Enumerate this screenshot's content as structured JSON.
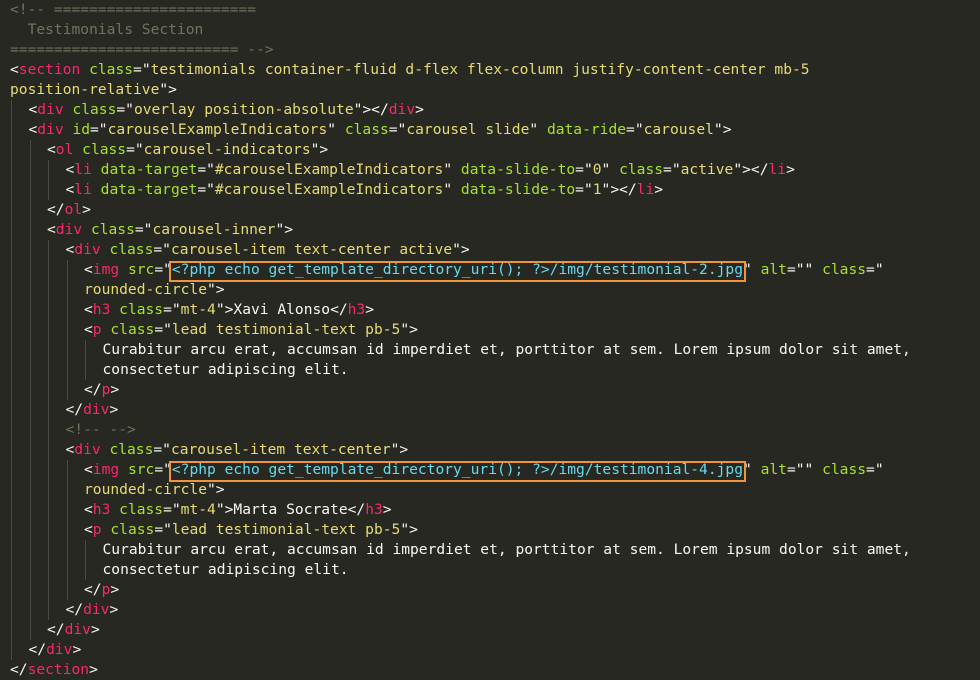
{
  "editor": {
    "theme": "monokai",
    "colors": {
      "background": "#272822",
      "text": "#f8f8f2",
      "comment": "#75715e",
      "tag": "#f92672",
      "attribute": "#a6e22e",
      "string": "#e6db74",
      "php": "#66d9ef",
      "highlight_box": "#f0953a"
    },
    "highlighted_lines": [
      13,
      23
    ],
    "lines": [
      {
        "indent": 0,
        "tokens": [
          {
            "t": "c",
            "v": "<!-- ======================="
          }
        ]
      },
      {
        "indent": 0,
        "tokens": [
          {
            "t": "c",
            "v": "  Testimonials Section"
          }
        ]
      },
      {
        "indent": 0,
        "tokens": [
          {
            "t": "c",
            "v": "========================== -->"
          }
        ]
      },
      {
        "indent": 0,
        "tokens": [
          {
            "t": "p",
            "v": "<"
          },
          {
            "t": "g",
            "v": "section"
          },
          {
            "t": "a",
            "v": " class"
          },
          {
            "t": "p",
            "v": "=\""
          },
          {
            "t": "s",
            "v": "testimonials container-fluid d-flex flex-column justify-content-center mb-5"
          }
        ]
      },
      {
        "indent": 0,
        "tokens": [
          {
            "t": "s",
            "v": "position-relative"
          },
          {
            "t": "p",
            "v": "\">"
          }
        ]
      },
      {
        "indent": 1,
        "tokens": [
          {
            "t": "p",
            "v": "<"
          },
          {
            "t": "g",
            "v": "div"
          },
          {
            "t": "a",
            "v": " class"
          },
          {
            "t": "p",
            "v": "=\""
          },
          {
            "t": "s",
            "v": "overlay position-absolute"
          },
          {
            "t": "p",
            "v": "\"></"
          },
          {
            "t": "g",
            "v": "div"
          },
          {
            "t": "p",
            "v": ">"
          }
        ]
      },
      {
        "indent": 1,
        "tokens": [
          {
            "t": "p",
            "v": "<"
          },
          {
            "t": "g",
            "v": "div"
          },
          {
            "t": "a",
            "v": " id"
          },
          {
            "t": "p",
            "v": "=\""
          },
          {
            "t": "s",
            "v": "carouselExampleIndicators"
          },
          {
            "t": "p",
            "v": "\""
          },
          {
            "t": "a",
            "v": " class"
          },
          {
            "t": "p",
            "v": "=\""
          },
          {
            "t": "s",
            "v": "carousel slide"
          },
          {
            "t": "p",
            "v": "\""
          },
          {
            "t": "a",
            "v": " data-ride"
          },
          {
            "t": "p",
            "v": "=\""
          },
          {
            "t": "s",
            "v": "carousel"
          },
          {
            "t": "p",
            "v": "\">"
          }
        ]
      },
      {
        "indent": 2,
        "tokens": [
          {
            "t": "p",
            "v": "<"
          },
          {
            "t": "g",
            "v": "ol"
          },
          {
            "t": "a",
            "v": " class"
          },
          {
            "t": "p",
            "v": "=\""
          },
          {
            "t": "s",
            "v": "carousel-indicators"
          },
          {
            "t": "p",
            "v": "\">"
          }
        ]
      },
      {
        "indent": 3,
        "tokens": [
          {
            "t": "p",
            "v": "<"
          },
          {
            "t": "g",
            "v": "li"
          },
          {
            "t": "a",
            "v": " data-target"
          },
          {
            "t": "p",
            "v": "=\""
          },
          {
            "t": "s",
            "v": "#carouselExampleIndicators"
          },
          {
            "t": "p",
            "v": "\""
          },
          {
            "t": "a",
            "v": " data-slide-to"
          },
          {
            "t": "p",
            "v": "=\""
          },
          {
            "t": "s",
            "v": "0"
          },
          {
            "t": "p",
            "v": "\""
          },
          {
            "t": "a",
            "v": " class"
          },
          {
            "t": "p",
            "v": "=\""
          },
          {
            "t": "s",
            "v": "active"
          },
          {
            "t": "p",
            "v": "\"></"
          },
          {
            "t": "g",
            "v": "li"
          },
          {
            "t": "p",
            "v": ">"
          }
        ]
      },
      {
        "indent": 3,
        "tokens": [
          {
            "t": "p",
            "v": "<"
          },
          {
            "t": "g",
            "v": "li"
          },
          {
            "t": "a",
            "v": " data-target"
          },
          {
            "t": "p",
            "v": "=\""
          },
          {
            "t": "s",
            "v": "#carouselExampleIndicators"
          },
          {
            "t": "p",
            "v": "\""
          },
          {
            "t": "a",
            "v": " data-slide-to"
          },
          {
            "t": "p",
            "v": "=\""
          },
          {
            "t": "s",
            "v": "1"
          },
          {
            "t": "p",
            "v": "\"></"
          },
          {
            "t": "g",
            "v": "li"
          },
          {
            "t": "p",
            "v": ">"
          }
        ]
      },
      {
        "indent": 2,
        "tokens": [
          {
            "t": "p",
            "v": "</"
          },
          {
            "t": "g",
            "v": "ol"
          },
          {
            "t": "p",
            "v": ">"
          }
        ]
      },
      {
        "indent": 2,
        "tokens": [
          {
            "t": "p",
            "v": "<"
          },
          {
            "t": "g",
            "v": "div"
          },
          {
            "t": "a",
            "v": " class"
          },
          {
            "t": "p",
            "v": "=\""
          },
          {
            "t": "s",
            "v": "carousel-inner"
          },
          {
            "t": "p",
            "v": "\">"
          }
        ]
      },
      {
        "indent": 3,
        "tokens": [
          {
            "t": "p",
            "v": "<"
          },
          {
            "t": "g",
            "v": "div"
          },
          {
            "t": "a",
            "v": " class"
          },
          {
            "t": "p",
            "v": "=\""
          },
          {
            "t": "s",
            "v": "carousel-item text-center active"
          },
          {
            "t": "p",
            "v": "\">"
          }
        ]
      },
      {
        "indent": 4,
        "tokens": [
          {
            "t": "p",
            "v": "<"
          },
          {
            "t": "g",
            "v": "img"
          },
          {
            "t": "a",
            "v": " src"
          },
          {
            "t": "p",
            "v": "=\""
          },
          {
            "t": "h",
            "v": "<?php echo get_template_directory_uri(); ?>/img/testimonial-2.jpg"
          },
          {
            "t": "p",
            "v": "\""
          },
          {
            "t": "a",
            "v": " alt"
          },
          {
            "t": "p",
            "v": "=\"\""
          },
          {
            "t": "a",
            "v": " class"
          },
          {
            "t": "p",
            "v": "=\""
          }
        ]
      },
      {
        "indent": 4,
        "tokens": [
          {
            "t": "s",
            "v": "rounded-circle"
          },
          {
            "t": "p",
            "v": "\">"
          }
        ]
      },
      {
        "indent": 4,
        "tokens": [
          {
            "t": "p",
            "v": "<"
          },
          {
            "t": "g",
            "v": "h3"
          },
          {
            "t": "a",
            "v": " class"
          },
          {
            "t": "p",
            "v": "=\""
          },
          {
            "t": "s",
            "v": "mt-4"
          },
          {
            "t": "p",
            "v": "\">"
          },
          {
            "t": "x",
            "v": "Xavi Alonso"
          },
          {
            "t": "p",
            "v": "</"
          },
          {
            "t": "g",
            "v": "h3"
          },
          {
            "t": "p",
            "v": ">"
          }
        ]
      },
      {
        "indent": 4,
        "tokens": [
          {
            "t": "p",
            "v": "<"
          },
          {
            "t": "g",
            "v": "p"
          },
          {
            "t": "a",
            "v": " class"
          },
          {
            "t": "p",
            "v": "=\""
          },
          {
            "t": "s",
            "v": "lead testimonial-text pb-5"
          },
          {
            "t": "p",
            "v": "\">"
          }
        ]
      },
      {
        "indent": 5,
        "tokens": [
          {
            "t": "x",
            "v": "Curabitur arcu erat, accumsan id imperdiet et, porttitor at sem. Lorem ipsum dolor sit amet,"
          }
        ]
      },
      {
        "indent": 5,
        "tokens": [
          {
            "t": "x",
            "v": "consectetur adipiscing elit."
          }
        ]
      },
      {
        "indent": 4,
        "tokens": [
          {
            "t": "p",
            "v": "</"
          },
          {
            "t": "g",
            "v": "p"
          },
          {
            "t": "p",
            "v": ">"
          }
        ]
      },
      {
        "indent": 3,
        "tokens": [
          {
            "t": "p",
            "v": "</"
          },
          {
            "t": "g",
            "v": "div"
          },
          {
            "t": "p",
            "v": ">"
          }
        ]
      },
      {
        "indent": 3,
        "tokens": [
          {
            "t": "c",
            "v": "<!-- -->"
          }
        ]
      },
      {
        "indent": 3,
        "tokens": [
          {
            "t": "p",
            "v": "<"
          },
          {
            "t": "g",
            "v": "div"
          },
          {
            "t": "a",
            "v": " class"
          },
          {
            "t": "p",
            "v": "=\""
          },
          {
            "t": "s",
            "v": "carousel-item text-center"
          },
          {
            "t": "p",
            "v": "\">"
          }
        ]
      },
      {
        "indent": 4,
        "tokens": [
          {
            "t": "p",
            "v": "<"
          },
          {
            "t": "g",
            "v": "img"
          },
          {
            "t": "a",
            "v": " src"
          },
          {
            "t": "p",
            "v": "=\""
          },
          {
            "t": "h",
            "v": "<?php echo get_template_directory_uri(); ?>/img/testimonial-4.jpg"
          },
          {
            "t": "p",
            "v": "\""
          },
          {
            "t": "a",
            "v": " alt"
          },
          {
            "t": "p",
            "v": "=\"\""
          },
          {
            "t": "a",
            "v": " class"
          },
          {
            "t": "p",
            "v": "=\""
          }
        ]
      },
      {
        "indent": 4,
        "tokens": [
          {
            "t": "s",
            "v": "rounded-circle"
          },
          {
            "t": "p",
            "v": "\">"
          }
        ]
      },
      {
        "indent": 4,
        "tokens": [
          {
            "t": "p",
            "v": "<"
          },
          {
            "t": "g",
            "v": "h3"
          },
          {
            "t": "a",
            "v": " class"
          },
          {
            "t": "p",
            "v": "=\""
          },
          {
            "t": "s",
            "v": "mt-4"
          },
          {
            "t": "p",
            "v": "\">"
          },
          {
            "t": "x",
            "v": "Marta Socrate"
          },
          {
            "t": "p",
            "v": "</"
          },
          {
            "t": "g",
            "v": "h3"
          },
          {
            "t": "p",
            "v": ">"
          }
        ]
      },
      {
        "indent": 4,
        "tokens": [
          {
            "t": "p",
            "v": "<"
          },
          {
            "t": "g",
            "v": "p"
          },
          {
            "t": "a",
            "v": " class"
          },
          {
            "t": "p",
            "v": "=\""
          },
          {
            "t": "s",
            "v": "lead testimonial-text pb-5"
          },
          {
            "t": "p",
            "v": "\">"
          }
        ]
      },
      {
        "indent": 5,
        "tokens": [
          {
            "t": "x",
            "v": "Curabitur arcu erat, accumsan id imperdiet et, porttitor at sem. Lorem ipsum dolor sit amet,"
          }
        ]
      },
      {
        "indent": 5,
        "tokens": [
          {
            "t": "x",
            "v": "consectetur adipiscing elit."
          }
        ]
      },
      {
        "indent": 4,
        "tokens": [
          {
            "t": "p",
            "v": "</"
          },
          {
            "t": "g",
            "v": "p"
          },
          {
            "t": "p",
            "v": ">"
          }
        ]
      },
      {
        "indent": 3,
        "tokens": [
          {
            "t": "p",
            "v": "</"
          },
          {
            "t": "g",
            "v": "div"
          },
          {
            "t": "p",
            "v": ">"
          }
        ]
      },
      {
        "indent": 2,
        "tokens": [
          {
            "t": "p",
            "v": "</"
          },
          {
            "t": "g",
            "v": "div"
          },
          {
            "t": "p",
            "v": ">"
          }
        ]
      },
      {
        "indent": 1,
        "tokens": [
          {
            "t": "p",
            "v": "</"
          },
          {
            "t": "g",
            "v": "div"
          },
          {
            "t": "p",
            "v": ">"
          }
        ]
      },
      {
        "indent": 0,
        "tokens": [
          {
            "t": "p",
            "v": "</"
          },
          {
            "t": "g",
            "v": "section"
          },
          {
            "t": "p",
            "v": ">"
          }
        ]
      }
    ]
  }
}
